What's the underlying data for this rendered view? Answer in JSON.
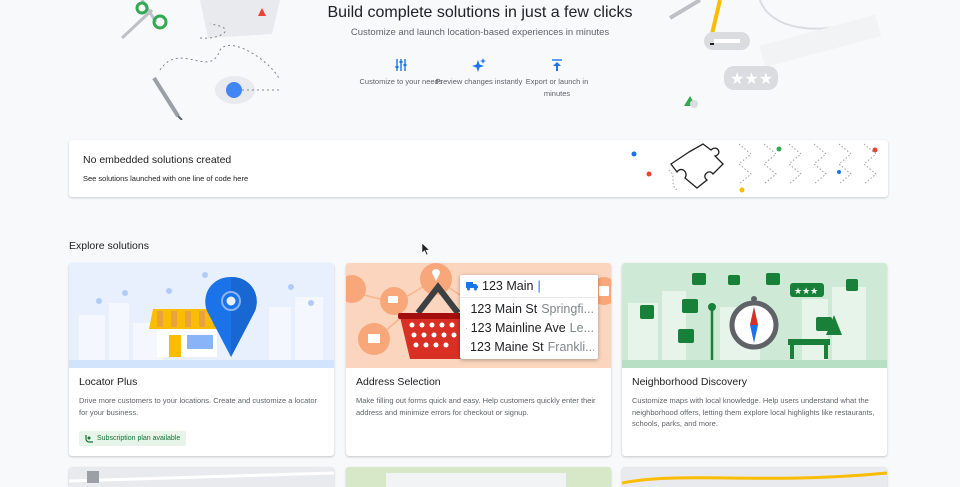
{
  "hero": {
    "title": "Build complete solutions in just a few clicks",
    "subtitle": "Customize and launch location-based experiences in minutes",
    "features": [
      {
        "icon": "tune-icon",
        "label": "Customize to your needs"
      },
      {
        "icon": "sparkle-icon",
        "label": "Preview changes instantly"
      },
      {
        "icon": "upload-icon",
        "label": "Export or launch in minutes"
      }
    ]
  },
  "empty_state": {
    "title": "No embedded solutions created",
    "link": "See solutions launched with one line of code here"
  },
  "explore": {
    "title": "Explore solutions",
    "cards": [
      {
        "title": "Locator Plus",
        "description": "Drive more customers to your locations. Create and customize a locator for your business.",
        "badge": "Subscription plan available"
      },
      {
        "title": "Address Selection",
        "description": "Make filling out forms quick and easy. Help customers quickly enter their address and minimize errors for checkout or signup.",
        "autocomplete": {
          "query": "123 Main",
          "suggestions": [
            {
              "main": "123 Main St",
              "secondary": "Springfi..."
            },
            {
              "main": "123 Mainline Ave",
              "secondary": "Le..."
            },
            {
              "main": "123 Maine St",
              "secondary": "Frankli..."
            }
          ]
        }
      },
      {
        "title": "Neighborhood Discovery",
        "description": "Customize maps with local knowledge. Help users understand what the neighborhood offers, letting them explore local highlights like restaurants, schools, parks, and more."
      }
    ]
  },
  "colors": {
    "blue": "#1a73e8",
    "green": "#137333",
    "red": "#ea4335",
    "yellow": "#fbbc04",
    "peach": "#fbd5bd",
    "mint": "#ceead6"
  }
}
